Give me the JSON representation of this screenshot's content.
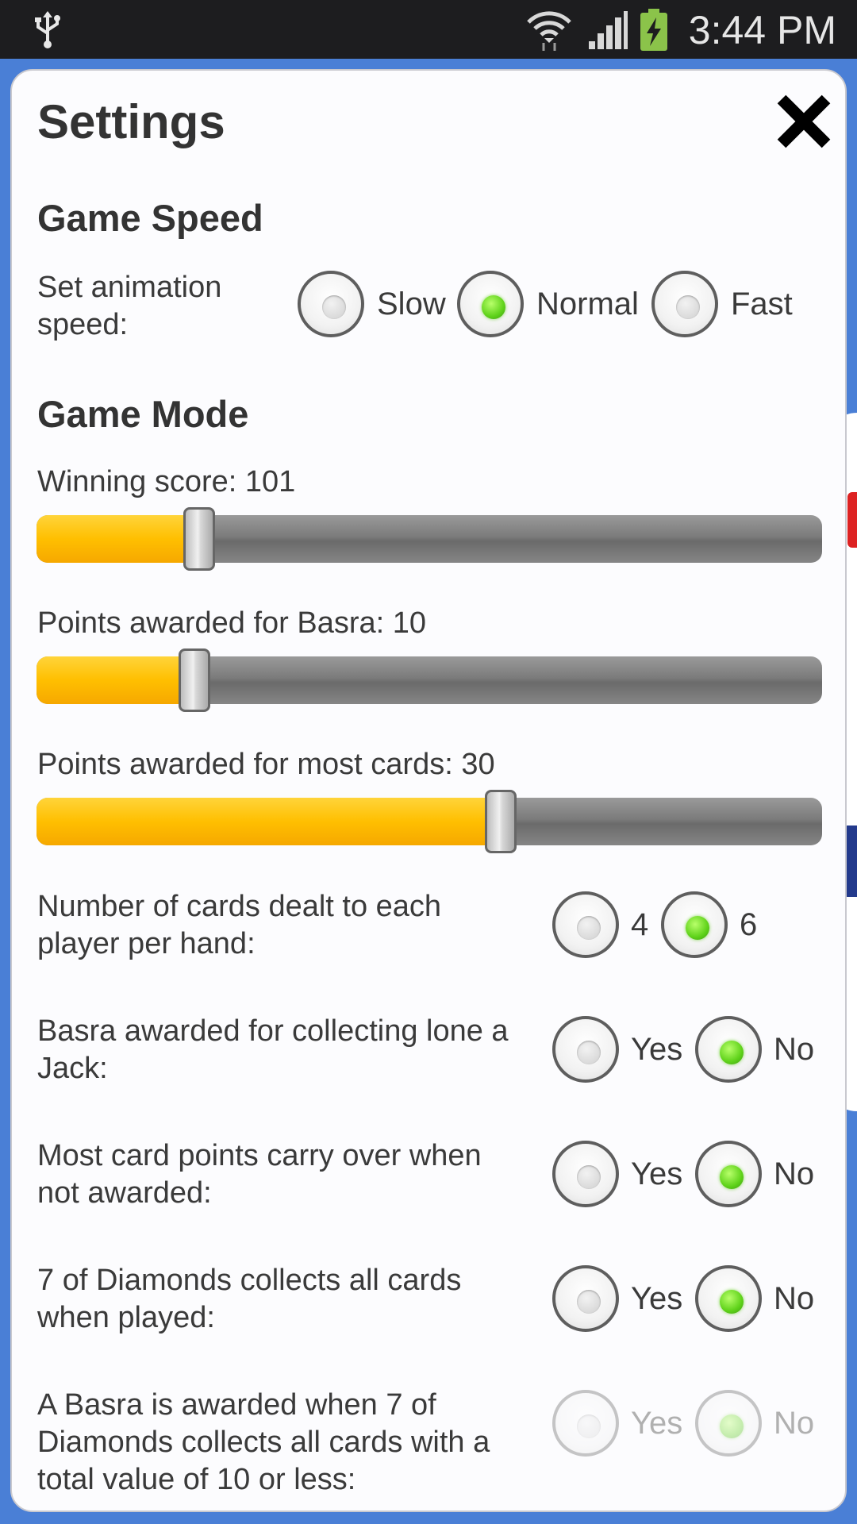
{
  "status_bar": {
    "time": "3:44 PM",
    "icons": [
      "usb-icon",
      "wifi-icon",
      "signal-icon",
      "battery-charging-icon"
    ]
  },
  "dialog": {
    "title": "Settings",
    "close_icon": "close-icon"
  },
  "game_speed": {
    "heading": "Game Speed",
    "label": "Set animation speed:",
    "label_line1": "Set animation",
    "label_line2": "speed:",
    "options": [
      "Slow",
      "Normal",
      "Fast"
    ],
    "selected": "Normal"
  },
  "game_mode": {
    "heading": "Game Mode",
    "winning_score": {
      "label": "Winning score: 101",
      "value": 101,
      "fraction": 0.2
    },
    "basra_points": {
      "label": "Points awarded for Basra: 10",
      "value": 10,
      "fraction": 0.2
    },
    "most_cards_points": {
      "label": "Points awarded for most cards: 30",
      "value": 30,
      "fraction": 0.6
    },
    "cards_dealt": {
      "line1": "Number of cards dealt to each",
      "line2": "player per hand:",
      "options": [
        "4",
        "6"
      ],
      "selected": "6"
    },
    "lone_jack": {
      "line1": "Basra awarded for collecting lone a",
      "line2": "Jack:",
      "options": [
        "Yes",
        "No"
      ],
      "selected": "No"
    },
    "carry_over": {
      "line1": "Most card points carry over when",
      "line2": "not awarded:",
      "options": [
        "Yes",
        "No"
      ],
      "selected": "No"
    },
    "seven_diamonds": {
      "line1": "7 of Diamonds collects all cards",
      "line2": "when played:",
      "options": [
        "Yes",
        "No"
      ],
      "selected": "No"
    },
    "seven_diamonds_basra": {
      "line1": "A Basra is awarded when 7 of",
      "line2": "Diamonds collects all cards with a",
      "line3": "total value of 10 or less:",
      "options": [
        "Yes",
        "No"
      ],
      "selected": "No",
      "disabled": true
    }
  },
  "colors": {
    "accent_fill": "#ffbf00",
    "radio_checked": "#5fd21a",
    "background": "#4a7fd6"
  }
}
